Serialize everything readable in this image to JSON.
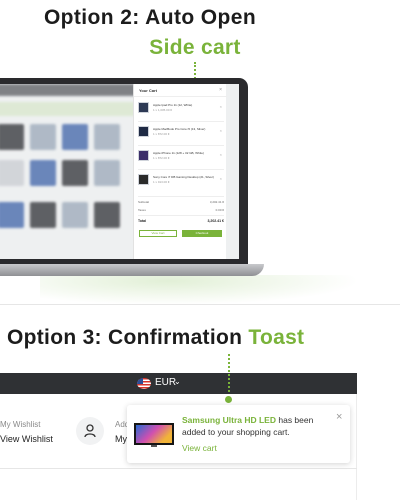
{
  "option2": {
    "title_line1": "Option 2: Auto Open",
    "title_line2": "Side cart"
  },
  "side_cart": {
    "title": "Your Cart",
    "close": "×",
    "items": [
      {
        "name": "Apple Ipad Pro 11 (12, White)",
        "qty": "1 x 1,005.00 €",
        "remove": "×"
      },
      {
        "name": "Apple MacBook Pro Core i5 (13, Silver)",
        "qty": "1 x 872.00 €",
        "remove": "×"
      },
      {
        "name": "Apple iPhone 11 (128 + 32 GB, White)",
        "qty": "1 x 872.00 €",
        "remove": "×"
      },
      {
        "name": "Sony Core i7 DB Gaming Desktop (21, Silver)",
        "qty": "1 x 913.00 €",
        "remove": "×"
      }
    ],
    "subtotal_label": "Subtotal",
    "subtotal_value": "3,202.41 €",
    "taxes_label": "Taxes",
    "taxes_value": "0.00 €",
    "total_label": "Total",
    "total_value": "3,202.41 €",
    "view_cart": "View Cart",
    "checkout": "Checkout"
  },
  "option3": {
    "title_prefix": "Option 3:  Confirmation",
    "title_highlight": "Toast"
  },
  "store": {
    "currency": "EUR",
    "wishlist_label": "My Wishlist",
    "wishlist_link": "View Wishlist",
    "account_label": "Add",
    "account_link": "My"
  },
  "toast": {
    "product": "Samsung Ultra HD LED",
    "message": " has been added to your shopping cart.",
    "view_cart": "View cart",
    "close": "×"
  },
  "colors": {
    "accent": "#7ab33a",
    "dark_bar": "#2f3134"
  }
}
